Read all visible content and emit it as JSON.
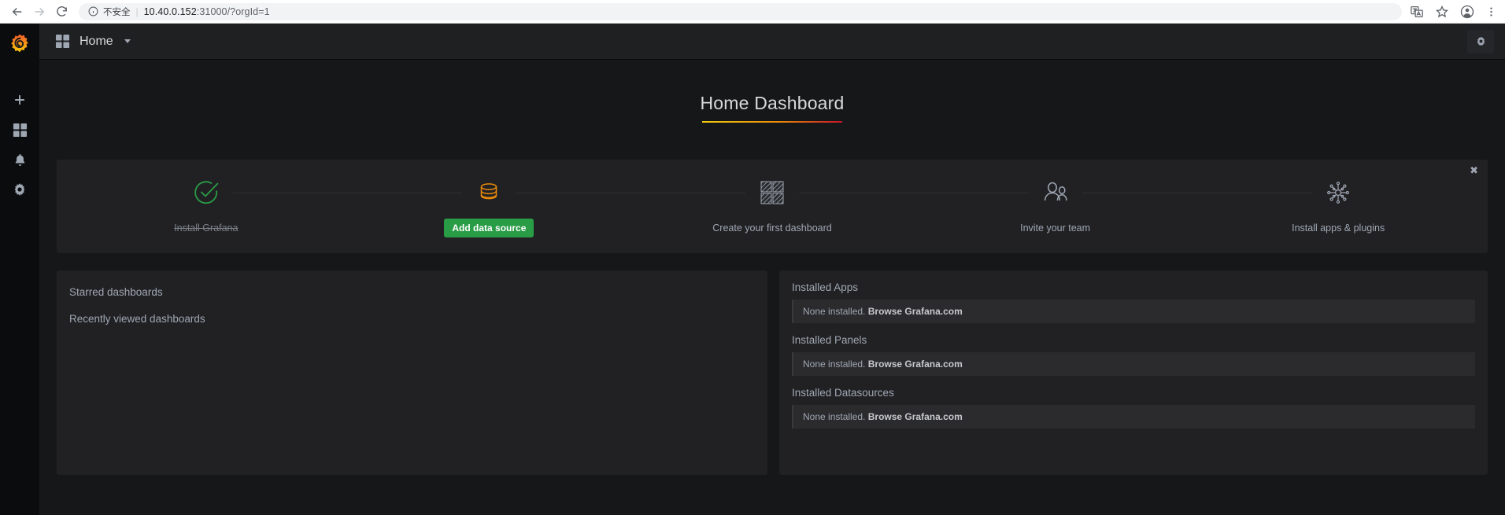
{
  "browser": {
    "back_icon": "arrow-left-icon",
    "forward_icon": "arrow-right-icon",
    "reload_icon": "reload-icon",
    "info_icon": "info-circle-icon",
    "security_label": "不安全",
    "separator": "|",
    "url_host": "10.40.0.152",
    "url_rest": ":31000/?orgId=1",
    "translate_icon": "translate-icon",
    "bookmark_icon": "star-icon",
    "profile_icon": "profile-avatar-icon",
    "menu_icon": "three-dot-menu-icon"
  },
  "sidebar": {
    "logo": "grafana-logo-icon",
    "items": [
      {
        "icon": "plus-icon",
        "name": "create"
      },
      {
        "icon": "dashboards-grid-icon",
        "name": "dashboards"
      },
      {
        "icon": "bell-icon",
        "name": "alerting"
      },
      {
        "icon": "gear-icon",
        "name": "configuration"
      }
    ]
  },
  "topnav": {
    "grid_icon": "dashboards-grid-icon",
    "title": "Home",
    "caret_icon": "chevron-down-icon",
    "settings_icon": "gear-icon"
  },
  "page": {
    "title": "Home Dashboard"
  },
  "onboarding": {
    "close_label": "✖",
    "steps": [
      {
        "label": "Install Grafana",
        "icon": "check-circle-icon",
        "state": "done",
        "button": null
      },
      {
        "label": "Add data source",
        "icon": "database-icon",
        "state": "current",
        "button": "Add data source"
      },
      {
        "label": "Create your first dashboard",
        "icon": "dashboard-hatched-icon",
        "state": "todo",
        "button": null
      },
      {
        "label": "Invite your team",
        "icon": "users-icon",
        "state": "todo",
        "button": null
      },
      {
        "label": "Install apps & plugins",
        "icon": "plugins-node-icon",
        "state": "todo",
        "button": null
      }
    ]
  },
  "dashboards_panel": {
    "links": [
      {
        "label": "Starred dashboards"
      },
      {
        "label": "Recently viewed dashboards"
      }
    ]
  },
  "installed_panel": {
    "sections": [
      {
        "heading": "Installed Apps",
        "none_text": "None installed.",
        "link_text": "Browse Grafana.com"
      },
      {
        "heading": "Installed Panels",
        "none_text": "None installed.",
        "link_text": "Browse Grafana.com"
      },
      {
        "heading": "Installed Datasources",
        "none_text": "None installed.",
        "link_text": "Browse Grafana.com"
      }
    ]
  },
  "colors": {
    "accent_green": "#299c46",
    "brand_orange": "#e8890a",
    "page_bg": "#161719",
    "panel_bg": "#212124"
  }
}
